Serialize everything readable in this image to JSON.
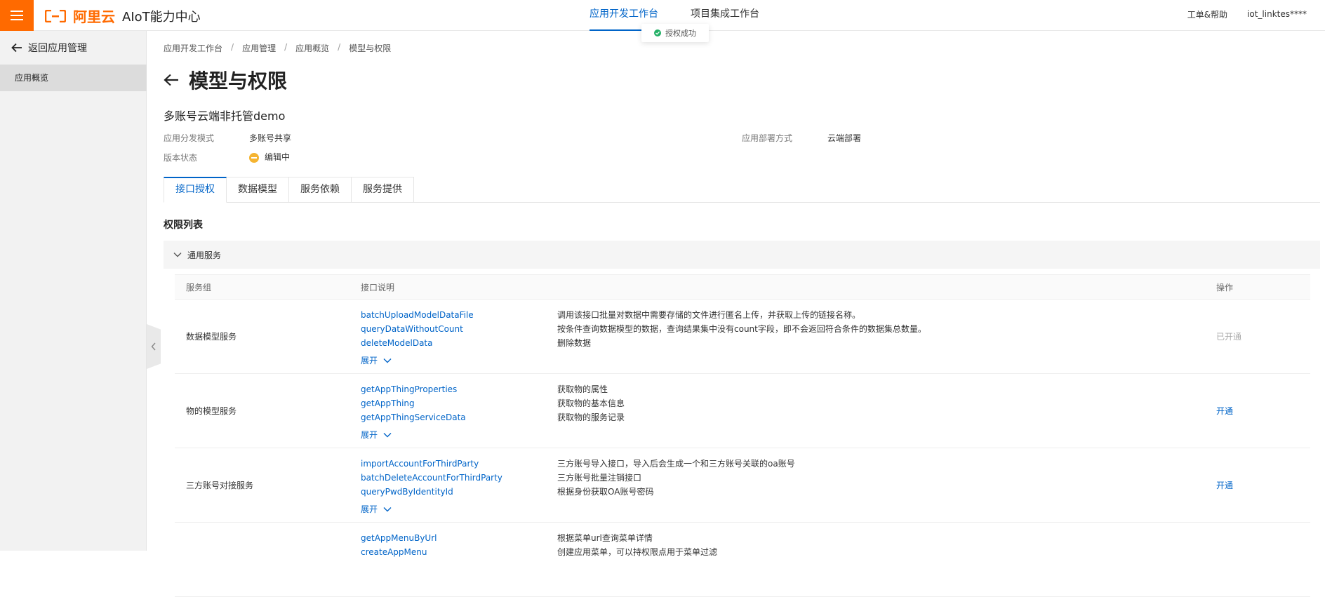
{
  "header": {
    "logo_text": "阿里云",
    "product_name": "AIoT能力中心",
    "tabs": [
      {
        "label": "应用开发工作台",
        "active": true
      },
      {
        "label": "项目集成工作台",
        "active": false
      }
    ],
    "help": "工单&帮助",
    "user": "iot_linktes****",
    "toast": "授权成功"
  },
  "sidebar": {
    "back_label": "返回应用管理",
    "items": [
      {
        "label": "应用概览",
        "active": true
      }
    ]
  },
  "breadcrumb": [
    "应用开发工作台",
    "应用管理",
    "应用概览",
    "模型与权限"
  ],
  "page": {
    "title": "模型与权限",
    "app_name": "多账号云端非托管demo",
    "info": {
      "dist_mode_label": "应用分发模式",
      "dist_mode_value": "多账号共享",
      "deploy_label": "应用部署方式",
      "deploy_value": "云端部署",
      "status_label": "版本状态",
      "status_value": "编辑中"
    },
    "tabs": [
      "接口授权",
      "数据模型",
      "服务依赖",
      "服务提供"
    ],
    "section_title": "权限列表",
    "group_title": "通用服务"
  },
  "table": {
    "headers": [
      "服务组",
      "接口说明",
      "操作"
    ],
    "expand_label": "展开",
    "rows": [
      {
        "group": "数据模型服务",
        "apis": [
          "batchUploadModelDataFile",
          "queryDataWithoutCount",
          "deleteModelData"
        ],
        "descs": [
          "调用该接口批量对数据中需要存储的文件进行匿名上传，并获取上传的链接名称。",
          "按条件查询数据模型的数据，查询结果集中没有count字段，即不会返回符合条件的数据集总数量。",
          "删除数据"
        ],
        "action": "已开通",
        "enabled": false
      },
      {
        "group": "物的模型服务",
        "apis": [
          "getAppThingProperties",
          "getAppThing",
          "getAppThingServiceData"
        ],
        "descs": [
          "获取物的属性",
          "获取物的基本信息",
          "获取物的服务记录"
        ],
        "action": "开通",
        "enabled": true
      },
      {
        "group": "三方账号对接服务",
        "apis": [
          "importAccountForThirdParty",
          "batchDeleteAccountForThirdParty",
          "queryPwdByIdentityId"
        ],
        "descs": [
          "三方账号导入接口，导入后会生成一个和三方账号关联的oa账号",
          "三方账号批量注销接口",
          "根据身份获取OA账号密码"
        ],
        "action": "开通",
        "enabled": true
      },
      {
        "group": "",
        "apis": [
          "getAppMenuByUrl",
          "createAppMenu"
        ],
        "descs": [
          "根据菜单url查询菜单详情",
          "创建应用菜单，可以持权限点用于菜单过滤"
        ],
        "action": "",
        "enabled": true
      }
    ]
  },
  "colors": {
    "accent": "#0064c8",
    "brand": "#ff6a00",
    "success": "#23b066",
    "warning": "#f5b431"
  }
}
